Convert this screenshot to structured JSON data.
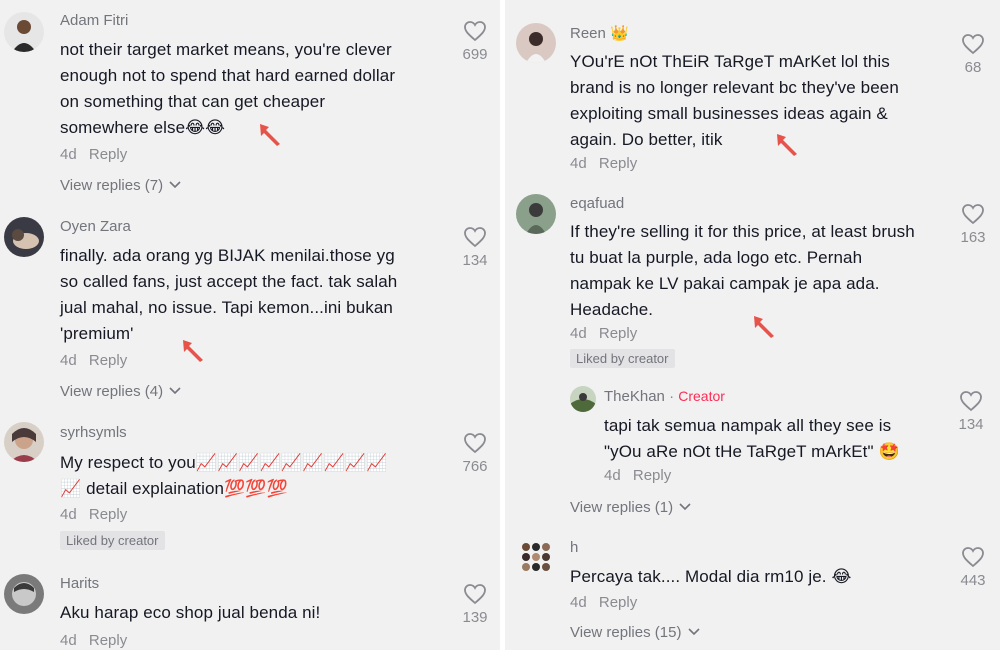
{
  "comments_left": [
    {
      "username": "Adam Fitri",
      "lines": [
        "not their target market means, you're clever",
        "enough not to spend that hard earned dollar",
        "on something that can get cheaper",
        "somewhere else😂😂"
      ],
      "time": "4d",
      "reply_label": "Reply",
      "likes": "699",
      "view_replies": "View replies (7)"
    },
    {
      "username": "Oyen Zara",
      "lines": [
        "finally. ada orang yg BIJAK menilai.those yg",
        "so called fans, just accept the fact. tak salah",
        "jual mahal, no issue. Tapi kemon...ini bukan",
        "'premium'"
      ],
      "time": "4d",
      "reply_label": "Reply",
      "likes": "134",
      "view_replies": "View replies (4)"
    },
    {
      "username": "syrhsymls",
      "lines": [
        "My respect to you📈📈📈📈📈📈📈📈📈",
        "📈 detail explaination💯💯💯"
      ],
      "time": "4d",
      "reply_label": "Reply",
      "likes": "766",
      "liked_by": "Liked by creator"
    },
    {
      "username": "Harits",
      "lines": [
        "Aku harap eco shop jual benda ni!"
      ],
      "time": "4d",
      "reply_label": "Reply",
      "likes": "139"
    }
  ],
  "comments_right": [
    {
      "username": "Reen",
      "badge": "👑",
      "lines": [
        "YOu'rE nOt ThEiR TaRgeT mArKet lol this",
        "brand is no longer relevant bc they've been",
        "exploiting small businesses ideas again &",
        "again. Do better, itik"
      ],
      "time": "4d",
      "reply_label": "Reply",
      "likes": "68"
    },
    {
      "username": "eqafuad",
      "lines": [
        "If they're selling it for this price, at least brush",
        "tu buat la purple, ada logo etc. Pernah",
        "nampak ke LV pakai campak je apa ada.",
        "Headache."
      ],
      "time": "4d",
      "reply_label": "Reply",
      "likes": "163",
      "liked_by": "Liked by creator",
      "reply": {
        "username": "TheKhan",
        "separator": "·",
        "creator_label": "Creator",
        "lines": [
          "tapi tak semua nampak all they see is",
          "\"yOu aRe nOt tHe TaRgeT mArkEt\" 🤩"
        ],
        "time": "4d",
        "reply_label": "Reply",
        "likes": "134"
      },
      "view_replies": "View replies (1)"
    },
    {
      "username": "h",
      "lines": [
        "Percaya tak.... Modal dia rm10 je. 😂"
      ],
      "time": "4d",
      "reply_label": "Reply",
      "likes": "443",
      "view_replies": "View replies (15)"
    }
  ],
  "icons": {
    "like": "heart-outline-icon",
    "chevron": "chevron-down-icon",
    "annotation": "red-arrow-annotation"
  },
  "colors": {
    "background": "#f1f1f2",
    "text": "#161823",
    "muted": "#8a8b91",
    "creator": "#fe2c55",
    "annotation": "#e5534b"
  }
}
